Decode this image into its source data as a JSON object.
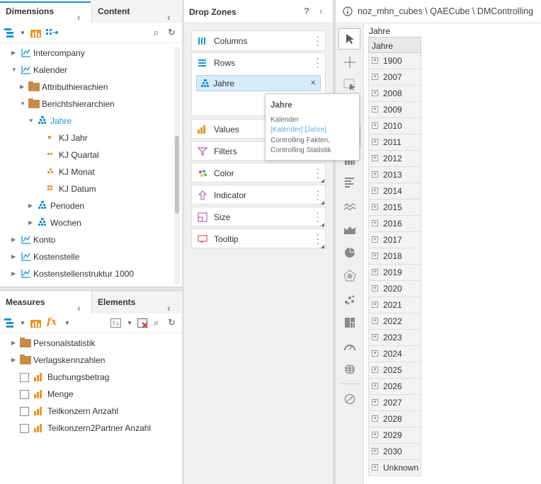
{
  "dimensions_panel": {
    "tab_dimensions": "Dimensions",
    "tab_content": "Content",
    "tree": [
      {
        "label": "Intercompany"
      },
      {
        "label": "Kalender"
      },
      {
        "label": "Attributhierachien"
      },
      {
        "label": "Berichtshierarchien"
      },
      {
        "label": "Jahre"
      },
      {
        "label": "KJ Jahr"
      },
      {
        "label": "KJ Quartal"
      },
      {
        "label": "KJ Monat"
      },
      {
        "label": "KJ Datum"
      },
      {
        "label": "Perioden"
      },
      {
        "label": "Wochen"
      },
      {
        "label": "Konto"
      },
      {
        "label": "Kostenstelle"
      },
      {
        "label": "Kostenstellenstruktur 1000"
      }
    ]
  },
  "measures_panel": {
    "tab_measures": "Measures",
    "tab_elements": "Elements",
    "tree": [
      {
        "label": "Personalstatistik"
      },
      {
        "label": "Verlagskennzahlen"
      },
      {
        "label": "Buchungsbetrag"
      },
      {
        "label": "Menge"
      },
      {
        "label": "Teilkonzern Anzahl"
      },
      {
        "label": "Teilkonzern2Partner Anzahl"
      }
    ]
  },
  "drop_zones": {
    "title": "Drop Zones",
    "help": "?",
    "zones": {
      "columns": "Columns",
      "rows": "Rows",
      "rows_chip": "Jahre",
      "values": "Values",
      "filters": "Filters",
      "color": "Color",
      "indicator": "Indicator",
      "size": "Size",
      "tooltip": "Tooltip"
    }
  },
  "tooltip_popup": {
    "title": "Jahre",
    "line1": "Kalender",
    "line2": "[Kalender].[Jahre]",
    "line3": "Controlling Fakten,",
    "line4": "Controlling Statistik"
  },
  "breadcrumb": "noz_mhn_cubes \\ QAECube \\ DMControlling",
  "grid": {
    "title": "Jahre",
    "header": "Jahre",
    "rows": [
      "1900",
      "2007",
      "2008",
      "2009",
      "2010",
      "2011",
      "2012",
      "2013",
      "2014",
      "2015",
      "2016",
      "2017",
      "2018",
      "2019",
      "2020",
      "2021",
      "2022",
      "2023",
      "2024",
      "2025",
      "2026",
      "2027",
      "2028",
      "2029",
      "2030",
      "Unknown"
    ]
  },
  "colors": {
    "accent_blue": "#1e90d6",
    "chip_bg": "#d7ecfa",
    "folder": "#c88a4a",
    "measure_orange": "#e8962e"
  }
}
